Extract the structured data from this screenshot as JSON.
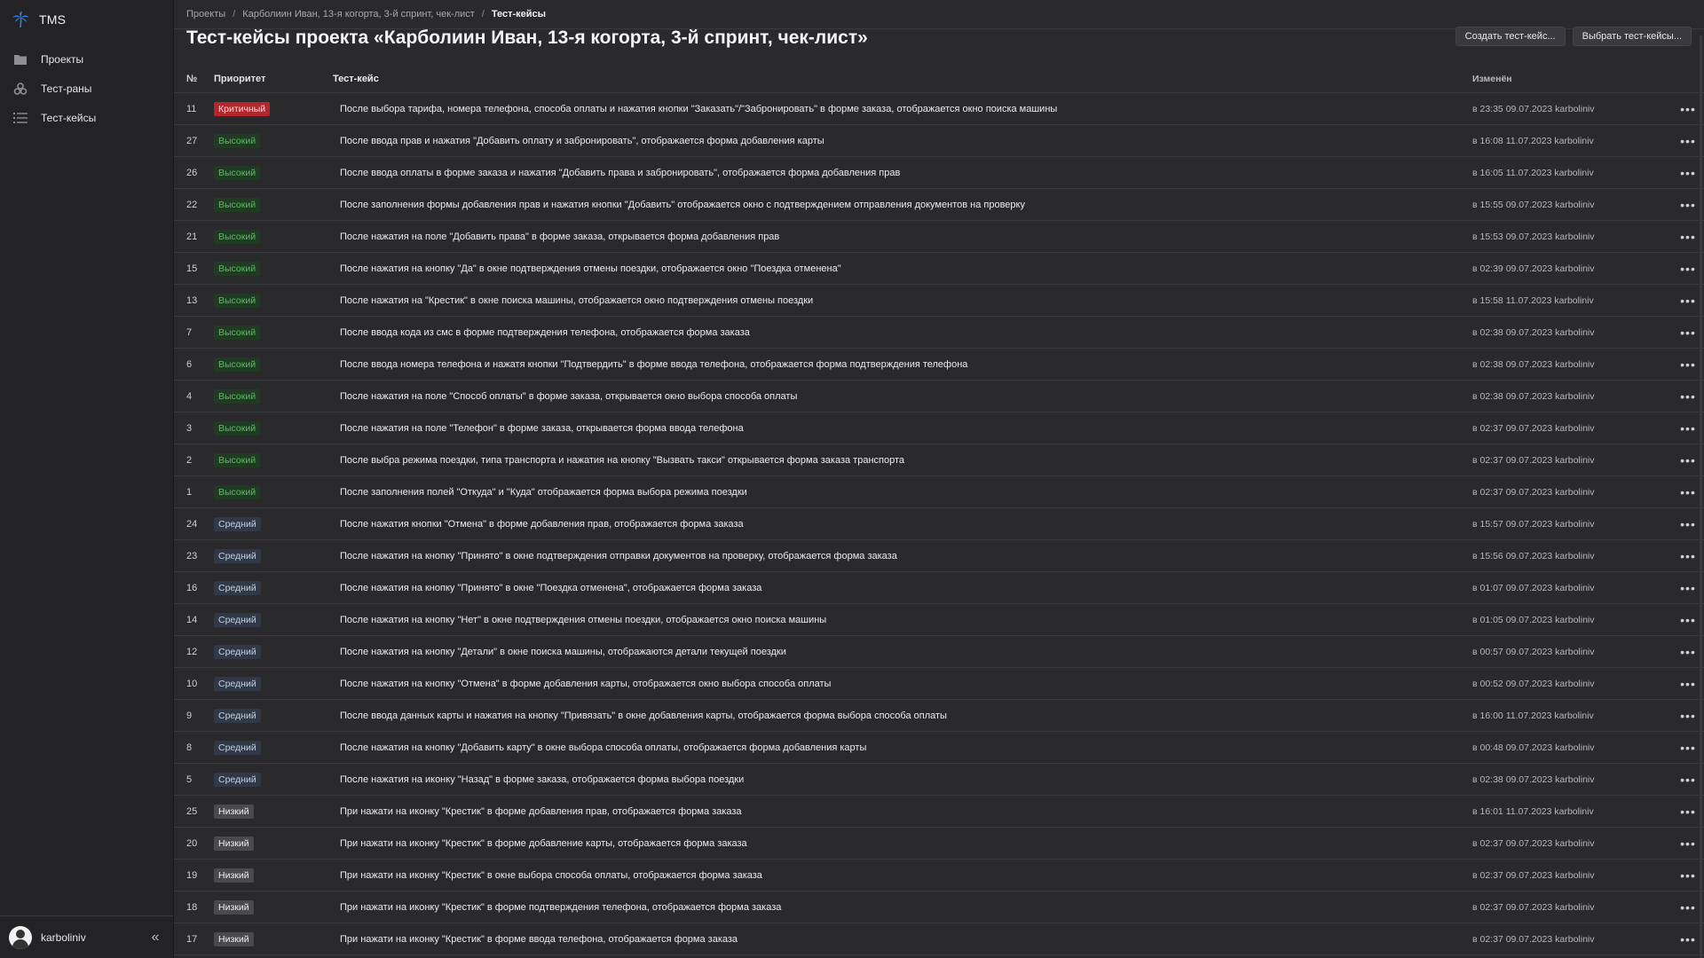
{
  "app": {
    "name": "TMS"
  },
  "sidebar": {
    "items": [
      {
        "label": "Проекты",
        "icon": "folder-icon"
      },
      {
        "label": "Тест-раны",
        "icon": "bio-runs-icon"
      },
      {
        "label": "Тест-кейсы",
        "icon": "list-icon"
      }
    ],
    "user": "karboliniv",
    "collapse_glyph": "«"
  },
  "breadcrumbs": {
    "items": [
      "Проекты",
      "Карболиин Иван, 13-я когорта, 3-й спринт, чек-лист",
      "Тест-кейсы"
    ],
    "separator": "/"
  },
  "page": {
    "title": "Тест-кейсы проекта «Карболиин Иван, 13-я когорта, 3-й спринт, чек-лист»",
    "create_button": "Создать тест-кейс...",
    "select_button": "Выбрать тест-кейсы..."
  },
  "table": {
    "headers": {
      "num": "№",
      "priority": "Приоритет",
      "case": "Тест-кейс",
      "modified": "Изменён"
    },
    "more_glyph": "•••",
    "rows": [
      {
        "num": "11",
        "priority": "Критичный",
        "level": "critical",
        "text": "После выбора тарифа, номера телефона, способа оплаты и нажатия кнопки \"Заказать\"/\"Забронировать\" в форме заказа, отображается окно поиска машины",
        "modified": "в 23:35 09.07.2023 karboliniv"
      },
      {
        "num": "27",
        "priority": "Высокий",
        "level": "high",
        "text": "После ввода прав и нажатия \"Добавить оплату и забронировать\", отображается форма добавления карты",
        "modified": "в 16:08 11.07.2023 karboliniv"
      },
      {
        "num": "26",
        "priority": "Высокий",
        "level": "high",
        "text": "После ввода оплаты в форме заказа и нажатия \"Добавить права и забронировать\", отображается форма добавления прав",
        "modified": "в 16:05 11.07.2023 karboliniv"
      },
      {
        "num": "22",
        "priority": "Высокий",
        "level": "high",
        "text": "После заполнения формы добавления прав и нажатия кнопки \"Добавить\" отображается окно с подтверждением отправления документов на проверку",
        "modified": "в 15:55 09.07.2023 karboliniv"
      },
      {
        "num": "21",
        "priority": "Высокий",
        "level": "high",
        "text": "После нажатия на поле \"Добавить права\" в форме заказа, открывается форма добавления прав",
        "modified": "в 15:53 09.07.2023 karboliniv"
      },
      {
        "num": "15",
        "priority": "Высокий",
        "level": "high",
        "text": "После нажатия на кнопку \"Да\" в окне подтверждения отмены поездки, отображается окно \"Поездка отменена\"",
        "modified": "в 02:39 09.07.2023 karboliniv"
      },
      {
        "num": "13",
        "priority": "Высокий",
        "level": "high",
        "text": "После нажатия на \"Крестик\" в окне поиска машины, отображается окно подтверждения отмены поездки",
        "modified": "в 15:58 11.07.2023 karboliniv"
      },
      {
        "num": "7",
        "priority": "Высокий",
        "level": "high",
        "text": "После ввода кода из смс в форме подтверждения телефона, отображается форма заказа",
        "modified": "в 02:38 09.07.2023 karboliniv"
      },
      {
        "num": "6",
        "priority": "Высокий",
        "level": "high",
        "text": "После ввода номера телефона и нажатя кнопки \"Подтвердить\" в форме ввода телефона, отображается форма подтверждения телефона",
        "modified": "в 02:38 09.07.2023 karboliniv"
      },
      {
        "num": "4",
        "priority": "Высокий",
        "level": "high",
        "text": "После нажатия на поле \"Способ оплаты\" в форме заказа, открывается окно выбора способа оплаты",
        "modified": "в 02:38 09.07.2023 karboliniv"
      },
      {
        "num": "3",
        "priority": "Высокий",
        "level": "high",
        "text": "После нажатия на поле \"Телефон\" в форме заказа, открывается форма ввода телефона",
        "modified": "в 02:37 09.07.2023 karboliniv"
      },
      {
        "num": "2",
        "priority": "Высокий",
        "level": "high",
        "text": "После выбра режима поездки, типа транспорта и нажатия на кнопку \"Вызвать такси\" открывается форма заказа транспорта",
        "modified": "в 02:37 09.07.2023 karboliniv"
      },
      {
        "num": "1",
        "priority": "Высокий",
        "level": "high",
        "text": "После заполнения полей \"Откуда\" и \"Куда\" отображается форма выбора режима поездки",
        "modified": "в 02:37 09.07.2023 karboliniv"
      },
      {
        "num": "24",
        "priority": "Средний",
        "level": "medium",
        "text": "После нажатия кнопки \"Отмена\" в форме добавления прав, отображается форма заказа",
        "modified": "в 15:57 09.07.2023 karboliniv"
      },
      {
        "num": "23",
        "priority": "Средний",
        "level": "medium",
        "text": "После нажатия на кнопку \"Принято\" в окне подтверждения отправки документов на проверку, отображается форма заказа",
        "modified": "в 15:56 09.07.2023 karboliniv"
      },
      {
        "num": "16",
        "priority": "Средний",
        "level": "medium",
        "text": "После нажатия на кнопку \"Принято\" в окне \"Поездка отменена\", отображается форма заказа",
        "modified": "в 01:07 09.07.2023 karboliniv"
      },
      {
        "num": "14",
        "priority": "Средний",
        "level": "medium",
        "text": "После нажатия на кнопку \"Нет\" в окне подтверждения отмены поездки, отображается окно поиска машины",
        "modified": "в 01:05 09.07.2023 karboliniv"
      },
      {
        "num": "12",
        "priority": "Средний",
        "level": "medium",
        "text": "После нажатия на кнопку \"Детали\" в окне поиска машины, отображаются детали текущей поездки",
        "modified": "в 00:57 09.07.2023 karboliniv"
      },
      {
        "num": "10",
        "priority": "Средний",
        "level": "medium",
        "text": "После нажатия на кнопку \"Отмена\" в форме добавления карты, отображается окно выбора способа оплаты",
        "modified": "в 00:52 09.07.2023 karboliniv"
      },
      {
        "num": "9",
        "priority": "Средний",
        "level": "medium",
        "text": "После ввода данных карты и нажатия на кнопку \"Привязать\" в окне добавления карты, отображается форма выбора способа оплаты",
        "modified": "в 16:00 11.07.2023 karboliniv"
      },
      {
        "num": "8",
        "priority": "Средний",
        "level": "medium",
        "text": "После нажатия на кнопку \"Добавить карту\" в окне выбора способа оплаты, отображается форма добавления карты",
        "modified": "в 00:48 09.07.2023 karboliniv"
      },
      {
        "num": "5",
        "priority": "Средний",
        "level": "medium",
        "text": "После нажатия на иконку \"Назад\" в форме заказа, отображается форма выбора поездки",
        "modified": "в 02:38 09.07.2023 karboliniv"
      },
      {
        "num": "25",
        "priority": "Низкий",
        "level": "low",
        "text": "При нажати на иконку \"Крестик\" в форме добавления прав, отображается форма заказа",
        "modified": "в 16:01 11.07.2023 karboliniv"
      },
      {
        "num": "20",
        "priority": "Низкий",
        "level": "low",
        "text": "При нажати на иконку \"Крестик\" в форме добавление карты, отображается форма заказа",
        "modified": "в 02:37 09.07.2023 karboliniv"
      },
      {
        "num": "19",
        "priority": "Низкий",
        "level": "low",
        "text": "При нажати на иконку \"Крестик\" в окне выбора способа оплаты, отображается форма заказа",
        "modified": "в 02:37 09.07.2023 karboliniv"
      },
      {
        "num": "18",
        "priority": "Низкий",
        "level": "low",
        "text": "При нажати на иконку \"Крестик\" в форме подтверждения телефона, отображается форма заказа",
        "modified": "в 02:37 09.07.2023 karboliniv"
      },
      {
        "num": "17",
        "priority": "Низкий",
        "level": "low",
        "text": "При нажати на иконку \"Крестик\" в форме ввода телефона, отображается форма заказа",
        "modified": "в 02:37 09.07.2023 karboliniv"
      }
    ]
  },
  "colors": {
    "background": "#2a2a2d",
    "sidebar": "#232326",
    "critical": "#b3262b",
    "high_text": "#4fc35a",
    "logo": "#2f7fd9"
  }
}
